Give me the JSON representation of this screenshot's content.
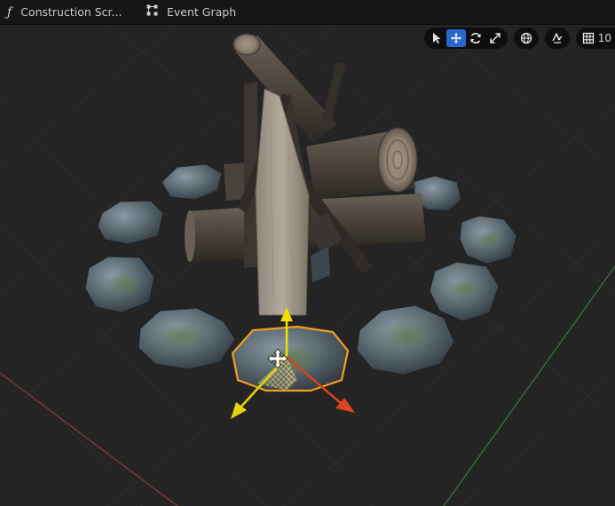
{
  "tabs": [
    {
      "label": "Construction Scr...",
      "icon": "function-icon"
    },
    {
      "label": "Event Graph",
      "icon": "event-graph-icon"
    }
  ],
  "toolbar": {
    "transform_modes": [
      {
        "name": "select-tool",
        "icon": "cursor-arrow-icon",
        "active": false
      },
      {
        "name": "translate-tool",
        "icon": "move-arrows-icon",
        "active": true
      },
      {
        "name": "rotate-tool",
        "icon": "rotate-icon",
        "active": false
      },
      {
        "name": "scale-tool",
        "icon": "scale-icon",
        "active": false
      }
    ],
    "world_local_icon": "globe-icon",
    "surface_snap_icon": "surface-snap-icon",
    "grid_snap_icon": "grid-icon",
    "grid_snap_value": "10"
  },
  "colors": {
    "active_tool": "#2b66c9",
    "selection_outline": "#f0a020",
    "gizmo_x": "#d8451e",
    "gizmo_y": "#e6d40a",
    "gizmo_z": "#f0e000",
    "grid_x_axis": "#8a3b3b",
    "grid_y_axis": "#3e7a3e",
    "background": "#242424"
  }
}
